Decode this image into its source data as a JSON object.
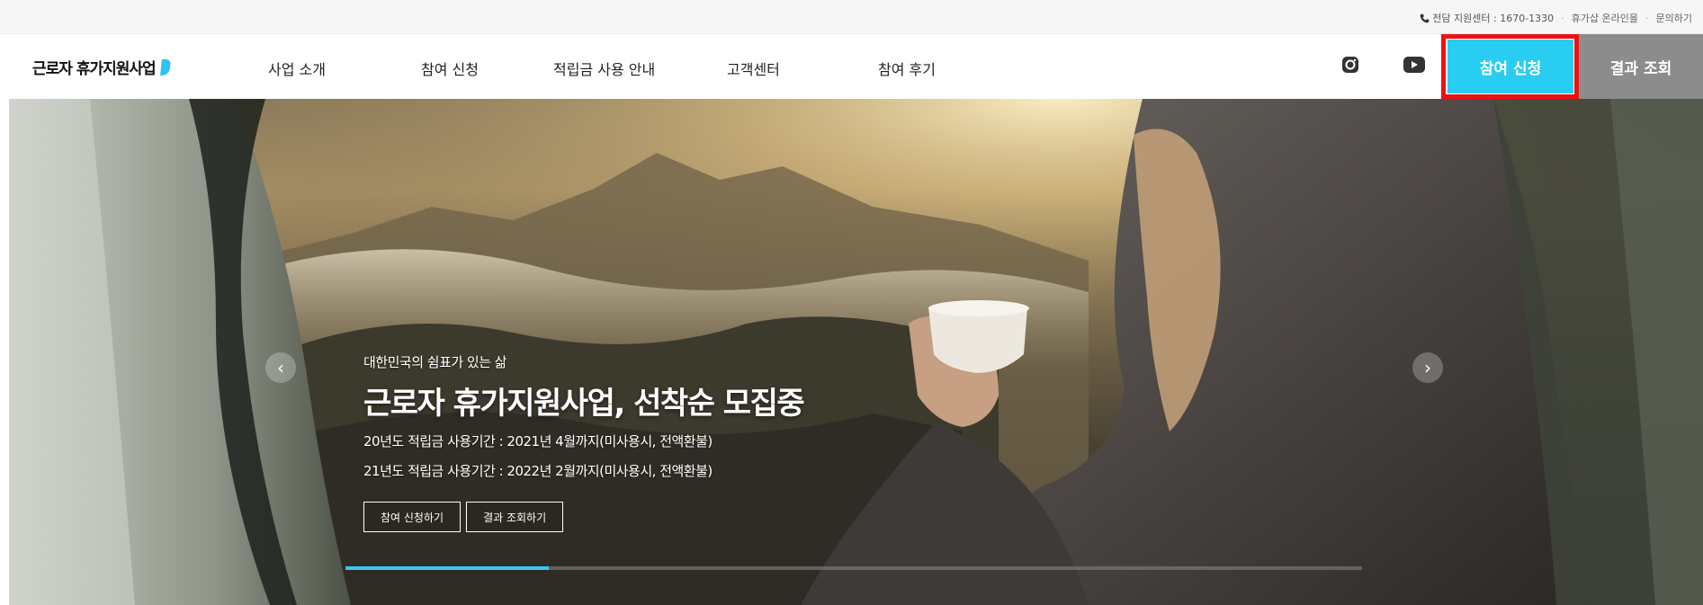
{
  "utility": {
    "phone_label": "전담 지원센터 : 1670-1330",
    "links": [
      "휴가샵 온라인몰",
      "문의하기"
    ]
  },
  "header": {
    "logo_text": "근로자 휴가지원사업",
    "nav": [
      "사업 소개",
      "참여 신청",
      "적립금 사용 안내",
      "고객센터",
      "참여 후기"
    ],
    "sns": [
      "instagram-icon",
      "youtube-icon"
    ],
    "apply_label": "참여 신청",
    "result_label": "결과 조회"
  },
  "hero": {
    "subtitle": "대한민국의 쉼표가 있는 삶",
    "title": "근로자 휴가지원사업, 선착순 모집중",
    "line1": "20년도 적립금 사용기간 : 2021년 4월까지(미사용시, 전액환불)",
    "line2": "21년도 적립금 사용기간 : 2022년 2월까지(미사용시, 전액환불)",
    "btn_apply": "참여 신청하기",
    "btn_result": "결과 조회하기",
    "prev_icon": "‹",
    "next_icon": "›",
    "progress": 0.2
  },
  "colors": {
    "accent": "#29cdf2",
    "result_bg": "#8c8c8c",
    "highlight": "#ee1111"
  }
}
